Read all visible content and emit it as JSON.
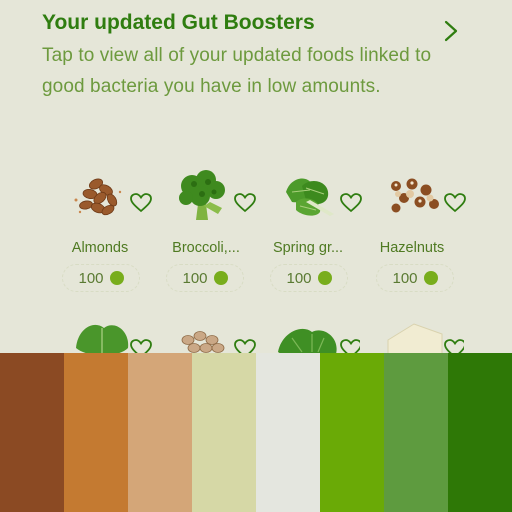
{
  "header": {
    "title": "Your updated Gut Boosters",
    "subtitle": "Tap to view all of your updated foods linked to good bacteria you have in low amounts."
  },
  "foods": [
    {
      "name": "Almonds",
      "score": "100"
    },
    {
      "name": "Broccoli,...",
      "score": "100"
    },
    {
      "name": "Spring gr...",
      "score": "100"
    },
    {
      "name": "Hazelnuts",
      "score": "100"
    }
  ],
  "colors": {
    "title": "#2f7d10",
    "subtitle": "#6d9a3e",
    "background": "#e5e6d8",
    "score_dot": "#78ad1c"
  },
  "palette": [
    "#8b4a23",
    "#c47a31",
    "#d4a678",
    "#d6d8a6",
    "#e4e6df",
    "#6aaa06",
    "#5e9b3f",
    "#2e7806"
  ]
}
